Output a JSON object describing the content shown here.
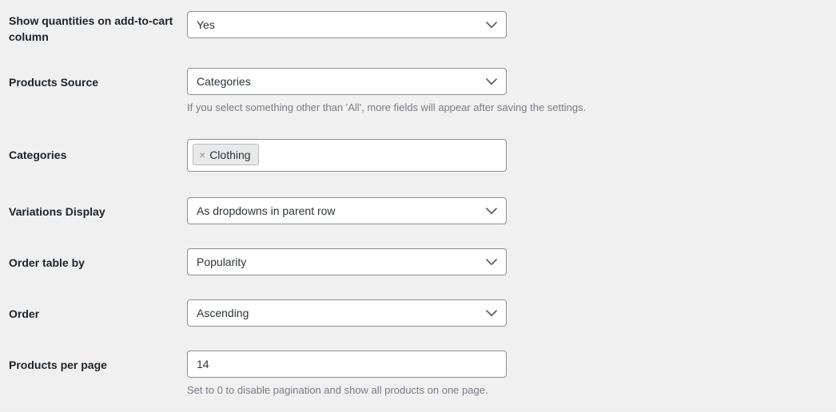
{
  "page": {
    "background_color": "#f0f0f1",
    "label_color": "#1d2327",
    "hint_color": "#787c82",
    "border_color": "#8c8f94",
    "field_background": "#ffffff",
    "token_background": "#e9e9e9"
  },
  "fields": {
    "quantities": {
      "label": "Show quantities on add-to-cart column",
      "value": "Yes",
      "icon": "chevron-down-icon"
    },
    "products_source": {
      "label": "Products Source",
      "value": "Categories",
      "icon": "chevron-down-icon",
      "hint": "If you select something other than 'All', more fields will appear after saving the settings."
    },
    "categories": {
      "label": "Categories",
      "tokens": [
        {
          "remove": "×",
          "label": "Clothing"
        }
      ]
    },
    "variations_display": {
      "label": "Variations Display",
      "value": "As dropdowns in parent row",
      "icon": "chevron-down-icon"
    },
    "order_table_by": {
      "label": "Order table by",
      "value": "Popularity",
      "icon": "chevron-down-icon"
    },
    "order": {
      "label": "Order",
      "value": "Ascending",
      "icon": "chevron-down-icon"
    },
    "products_per_page": {
      "label": "Products per page",
      "value": "14",
      "hint": "Set to 0 to disable pagination and show all products on one page."
    }
  }
}
